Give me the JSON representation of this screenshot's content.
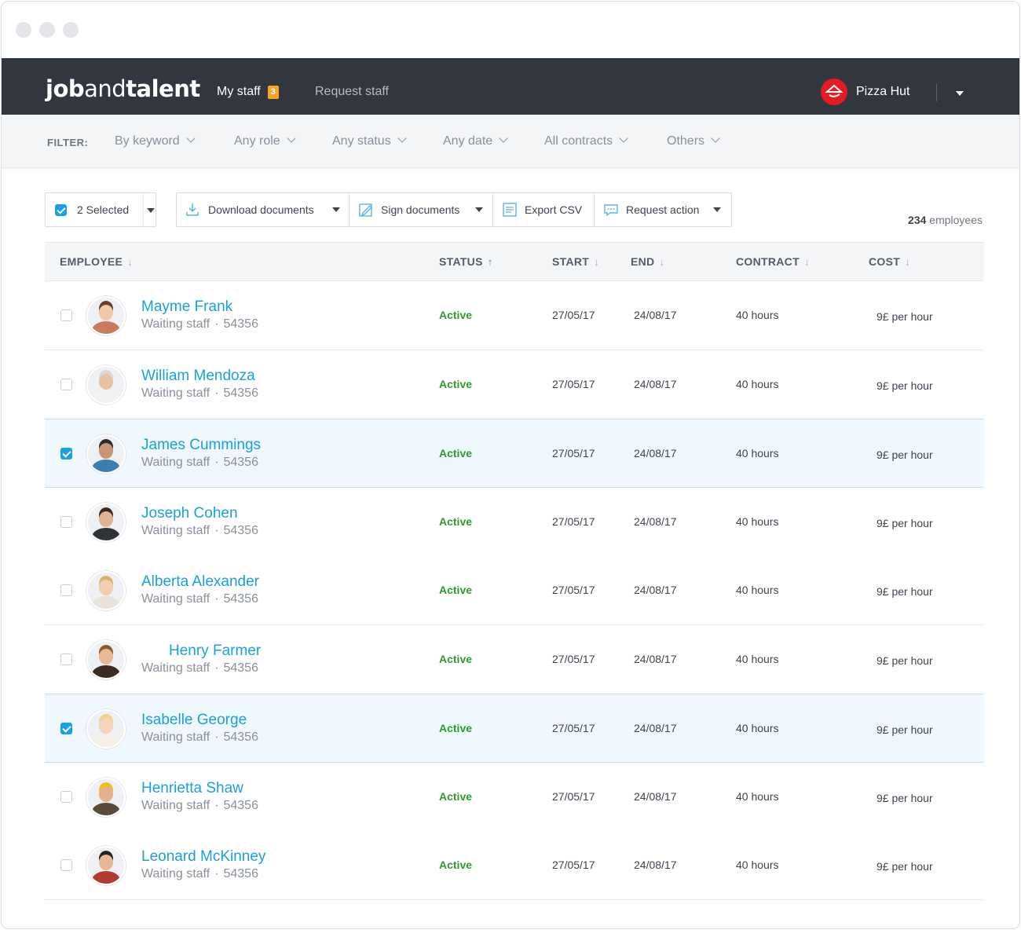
{
  "app": {
    "logo_bold_1": "job",
    "logo_light": "and",
    "logo_bold_2": "talent"
  },
  "nav": {
    "my_staff": "My staff",
    "my_staff_badge": "3",
    "request_staff": "Request staff",
    "company": "Pizza Hut",
    "brand_color": "#e41b23",
    "bg_color": "#32373f"
  },
  "filters": {
    "label": "FILTER:",
    "items": [
      "By keyword",
      "Any role",
      "Any status",
      "Any date",
      "All contracts",
      "Others"
    ]
  },
  "toolbar": {
    "selected_label": "2 Selected",
    "download": "Download documents",
    "sign": "Sign documents",
    "export": "Export CSV",
    "request": "Request action"
  },
  "summary": {
    "count": "234",
    "count_suffix": " employees"
  },
  "table": {
    "headers": {
      "employee": "EMPLOYEE",
      "status": "STATUS",
      "start": "START",
      "end": "END",
      "contract": "CONTRACT",
      "cost": "COST"
    },
    "sort_icon": "↓",
    "sort_active_icon": "↑",
    "accent_color": "#1a9fe0",
    "rows": [
      {
        "name": "Mayme Frank",
        "role": "Waiting staff",
        "id": "54356",
        "status": "Active",
        "start": "27/05/17",
        "end": "24/08/17",
        "contract": "40 hours",
        "cost": "9£ per hour",
        "selected": false,
        "hair": "#6b3e26",
        "skin": "#f0c7a8",
        "shirt": "#c77c5e"
      },
      {
        "name": "William Mendoza",
        "role": "Waiting staff",
        "id": "54356",
        "status": "Active",
        "start": "27/05/17",
        "end": "24/08/17",
        "contract": "40 hours",
        "cost": "9£ per hour",
        "selected": false,
        "hair": "#d9d9d9",
        "skin": "#e9c1a2",
        "shirt": "#f2f2f2"
      },
      {
        "name": "James Cummings",
        "role": "Waiting staff",
        "id": "54356",
        "status": "Active",
        "start": "27/05/17",
        "end": "24/08/17",
        "contract": "40 hours",
        "cost": "9£ per hour",
        "selected": true,
        "hair": "#2b2b2b",
        "skin": "#c99575",
        "shirt": "#3a7fb0"
      },
      {
        "name": "Joseph Cohen",
        "role": "Waiting staff",
        "id": "54356",
        "status": "Active",
        "start": "27/05/17",
        "end": "24/08/17",
        "contract": "40 hours",
        "cost": "9£ per hour",
        "selected": false,
        "hair": "#3a2a1e",
        "skin": "#e0b394",
        "shirt": "#2f3338"
      },
      {
        "name": "Alberta Alexander",
        "role": "Waiting staff",
        "id": "54356",
        "status": "Active",
        "start": "27/05/17",
        "end": "24/08/17",
        "contract": "40 hours",
        "cost": "9£ per hour",
        "selected": false,
        "hair": "#d8b36a",
        "skin": "#f2cdb2",
        "shirt": "#e8e4dc"
      },
      {
        "name": "Henry Farmer",
        "role": "Waiting staff",
        "id": "54356",
        "status": "Active",
        "start": "27/05/17",
        "end": "24/08/17",
        "contract": "40 hours",
        "cost": "9£ per hour",
        "selected": false,
        "hair": "#8a5a2b",
        "skin": "#e8b995",
        "shirt": "#3b2a22"
      },
      {
        "name": "Isabelle George",
        "role": "Waiting staff",
        "id": "54356",
        "status": "Active",
        "start": "27/05/17",
        "end": "24/08/17",
        "contract": "40 hours",
        "cost": "9£ per hour",
        "selected": true,
        "hair": "#f0d48c",
        "skin": "#f6d3bb",
        "shirt": "#f4efe7"
      },
      {
        "name": "Henrietta Shaw",
        "role": "Waiting staff",
        "id": "54356",
        "status": "Active",
        "start": "27/05/17",
        "end": "24/08/17",
        "contract": "40 hours",
        "cost": "9£ per hour",
        "selected": false,
        "hair": "#e6c21a",
        "skin": "#e4b08e",
        "shirt": "#5a4a3a"
      },
      {
        "name": "Leonard McKinney",
        "role": "Waiting staff",
        "id": "54356",
        "status": "Active",
        "start": "27/05/17",
        "end": "24/08/17",
        "contract": "40 hours",
        "cost": "9£ per hour",
        "selected": false,
        "hair": "#2a2320",
        "skin": "#e6b896",
        "shirt": "#b23a2e"
      }
    ]
  }
}
